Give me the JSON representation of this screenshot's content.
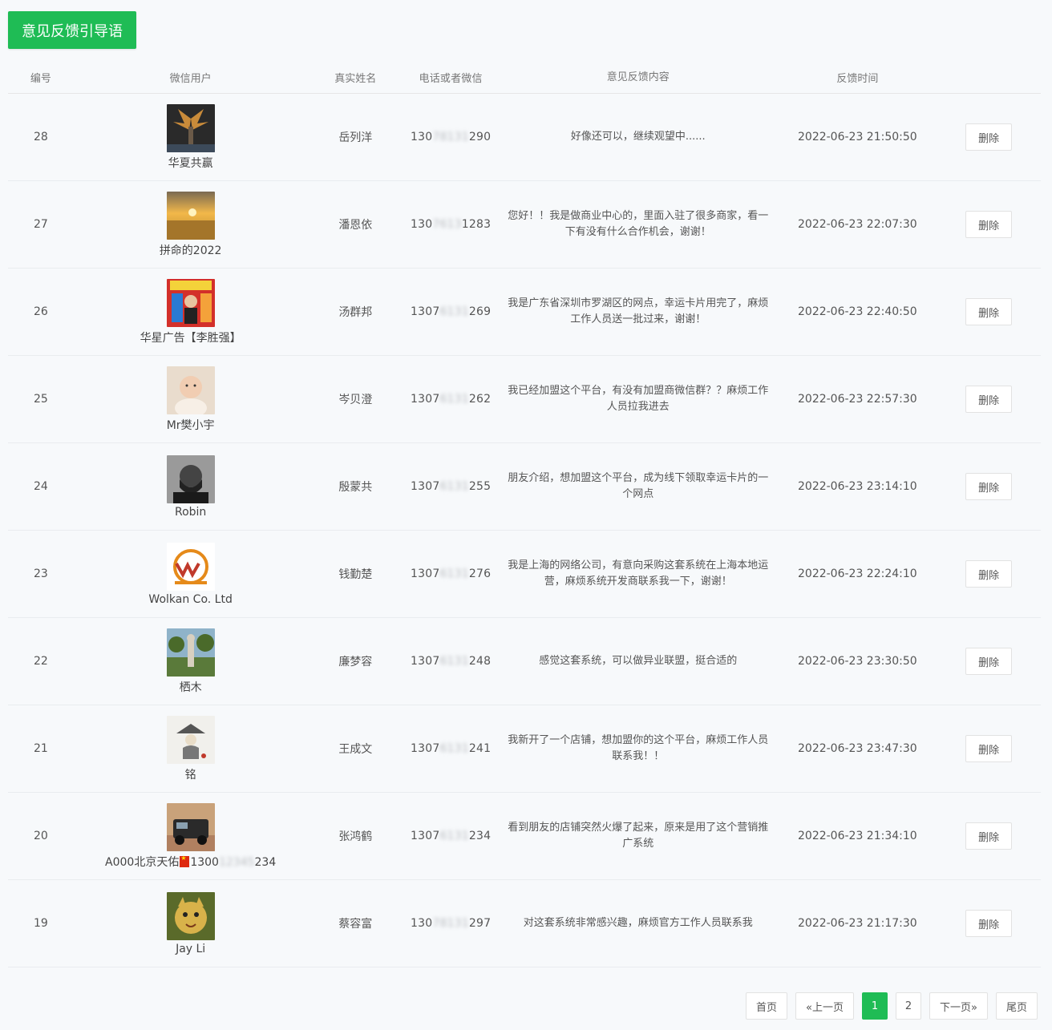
{
  "top_button": "意见反馈引导语",
  "columns": {
    "id": "编号",
    "user": "微信用户",
    "name": "真实姓名",
    "phone": "电话或者微信",
    "content": "意见反馈内容",
    "time": "反馈时间"
  },
  "rows": [
    {
      "id": "28",
      "nick": "华夏共赢",
      "name": "岳列洋",
      "phone_a": "130",
      "phone_b": "78131",
      "phone_c": "290",
      "content": "好像还可以，继续观望中......",
      "time": "2022-06-23 21:50:50",
      "action": "删除",
      "avatar": "phoenix"
    },
    {
      "id": "27",
      "nick": "拼命的2022",
      "name": "潘恩依",
      "phone_a": "130",
      "phone_b": "7613",
      "phone_c": "1283",
      "content": "您好！！我是做商业中心的，里面入驻了很多商家，看一下有没有什么合作机会，谢谢！",
      "time": "2022-06-23 22:07:30",
      "action": "删除",
      "avatar": "sunset"
    },
    {
      "id": "26",
      "nick": "华星广告【李胜强】",
      "name": "汤群邦",
      "phone_a": "1307",
      "phone_b": "6131",
      "phone_c": "269",
      "content": "我是广东省深圳市罗湖区的网点，幸运卡片用完了，麻烦工作人员送一批过来，谢谢！",
      "time": "2022-06-23 22:40:50",
      "action": "删除",
      "avatar": "poster"
    },
    {
      "id": "25",
      "nick": "Mr樊小宇",
      "name": "岑贝澄",
      "phone_a": "1307",
      "phone_b": "6131",
      "phone_c": "262",
      "content": "我已经加盟这个平台，有没有加盟商微信群？？麻烦工作人员拉我进去",
      "time": "2022-06-23 22:57:30",
      "action": "删除",
      "avatar": "baby"
    },
    {
      "id": "24",
      "nick": "Robin",
      "name": "殷蒙共",
      "phone_a": "1307",
      "phone_b": "6131",
      "phone_c": "255",
      "content": "朋友介绍，想加盟这个平台，成为线下领取幸运卡片的一个网点",
      "time": "2022-06-23 23:14:10",
      "action": "删除",
      "avatar": "man"
    },
    {
      "id": "23",
      "nick": "Wolkan Co. Ltd",
      "name": "钱勤楚",
      "phone_a": "1307",
      "phone_b": "6131",
      "phone_c": "276",
      "content": "我是上海的网络公司，有意向采购这套系统在上海本地运营，麻烦系统开发商联系我一下，谢谢！",
      "time": "2022-06-23 22:24:10",
      "action": "删除",
      "avatar": "logo"
    },
    {
      "id": "22",
      "nick": "栖木",
      "name": "廉梦容",
      "phone_a": "1307",
      "phone_b": "6131",
      "phone_c": "248",
      "content": "感觉这套系统，可以做异业联盟，挺合适的",
      "time": "2022-06-23 23:30:50",
      "action": "删除",
      "avatar": "statue"
    },
    {
      "id": "21",
      "nick": "铭",
      "name": "王成文",
      "phone_a": "1307",
      "phone_b": "6131",
      "phone_c": "241",
      "content": "我新开了一个店铺，想加盟你的这个平台，麻烦工作人员联系我！！",
      "time": "2022-06-23 23:47:30",
      "action": "删除",
      "avatar": "ink"
    },
    {
      "id": "20",
      "nick_a": "A000北京天佑",
      "nick_b": "1300",
      "nick_blur": "12345",
      "nick_c": "234",
      "name": "张鸿鹤",
      "phone_a": "1307",
      "phone_b": "6131",
      "phone_c": "234",
      "content": "看到朋友的店铺突然火爆了起来，原来是用了这个营销推广系统",
      "time": "2022-06-23 21:34:10",
      "action": "删除",
      "avatar": "jeep"
    },
    {
      "id": "19",
      "nick": "Jay Li",
      "name": "蔡容富",
      "phone_a": "130",
      "phone_b": "78131",
      "phone_c": "297",
      "content": "对这套系统非常感兴趣，麻烦官方工作人员联系我",
      "time": "2022-06-23 21:17:30",
      "action": "删除",
      "avatar": "cat"
    }
  ],
  "pager": {
    "first": "首页",
    "prev": "«上一页",
    "page1": "1",
    "page2": "2",
    "next": "下一页»",
    "last": "尾页"
  },
  "accent": "#1fbc55"
}
